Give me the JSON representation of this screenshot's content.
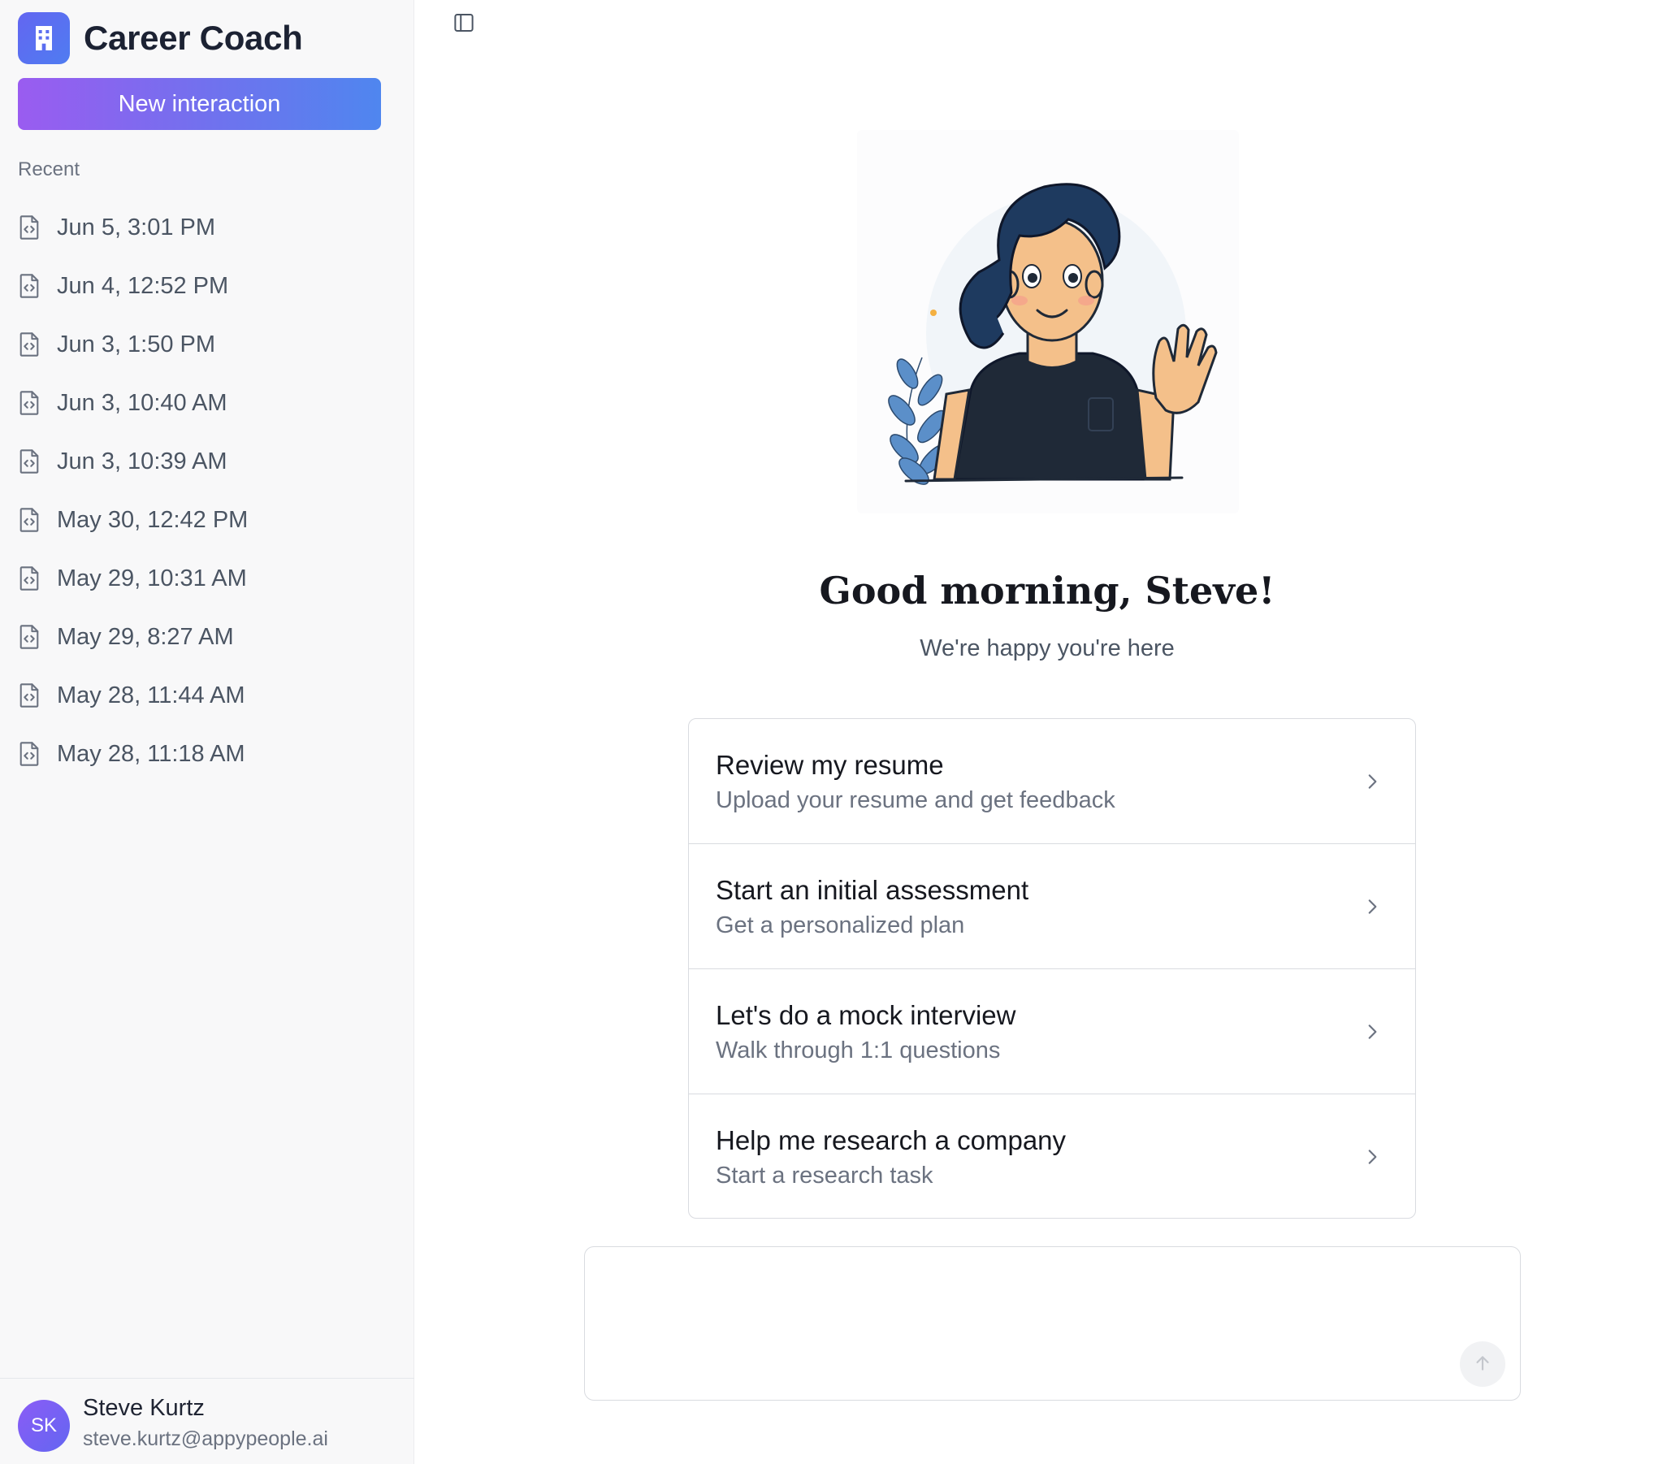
{
  "app": {
    "title": "Career Coach",
    "logo_icon": "building-icon",
    "accent_gradient": [
      "#9a5cf0",
      "#4f86ef"
    ]
  },
  "sidebar": {
    "new_button_label": "New interaction",
    "recent_label": "Recent",
    "recent_items": [
      {
        "label": "Jun 5, 3:01 PM",
        "icon": "code-document-icon"
      },
      {
        "label": "Jun 4, 12:52 PM",
        "icon": "code-document-icon"
      },
      {
        "label": "Jun 3, 1:50 PM",
        "icon": "code-document-icon"
      },
      {
        "label": "Jun 3, 10:40 AM",
        "icon": "code-document-icon"
      },
      {
        "label": "Jun 3, 10:39 AM",
        "icon": "code-document-icon"
      },
      {
        "label": "May 30, 12:42 PM",
        "icon": "code-document-icon"
      },
      {
        "label": "May 29, 10:31 AM",
        "icon": "code-document-icon"
      },
      {
        "label": "May 29, 8:27 AM",
        "icon": "code-document-icon"
      },
      {
        "label": "May 28, 11:44 AM",
        "icon": "code-document-icon"
      },
      {
        "label": "May 28, 11:18 AM",
        "icon": "code-document-icon"
      }
    ],
    "user": {
      "initials": "SK",
      "name": "Steve Kurtz",
      "email": "steve.kurtz@appypeople.ai"
    }
  },
  "main": {
    "toggle_icon": "sidebar-toggle-icon",
    "illustration": "waving-person-illustration",
    "greeting": "Good morning, Steve!",
    "subgreeting": "We're happy you're here",
    "options": [
      {
        "title": "Review my resume",
        "subtitle": "Upload your resume and get feedback"
      },
      {
        "title": "Start an initial assessment",
        "subtitle": "Get a personalized plan"
      },
      {
        "title": "Let's do a mock interview",
        "subtitle": "Walk through 1:1 questions"
      },
      {
        "title": "Help me research a company",
        "subtitle": "Start a research task"
      }
    ],
    "composer": {
      "placeholder": "",
      "send_icon": "arrow-up-icon"
    }
  }
}
